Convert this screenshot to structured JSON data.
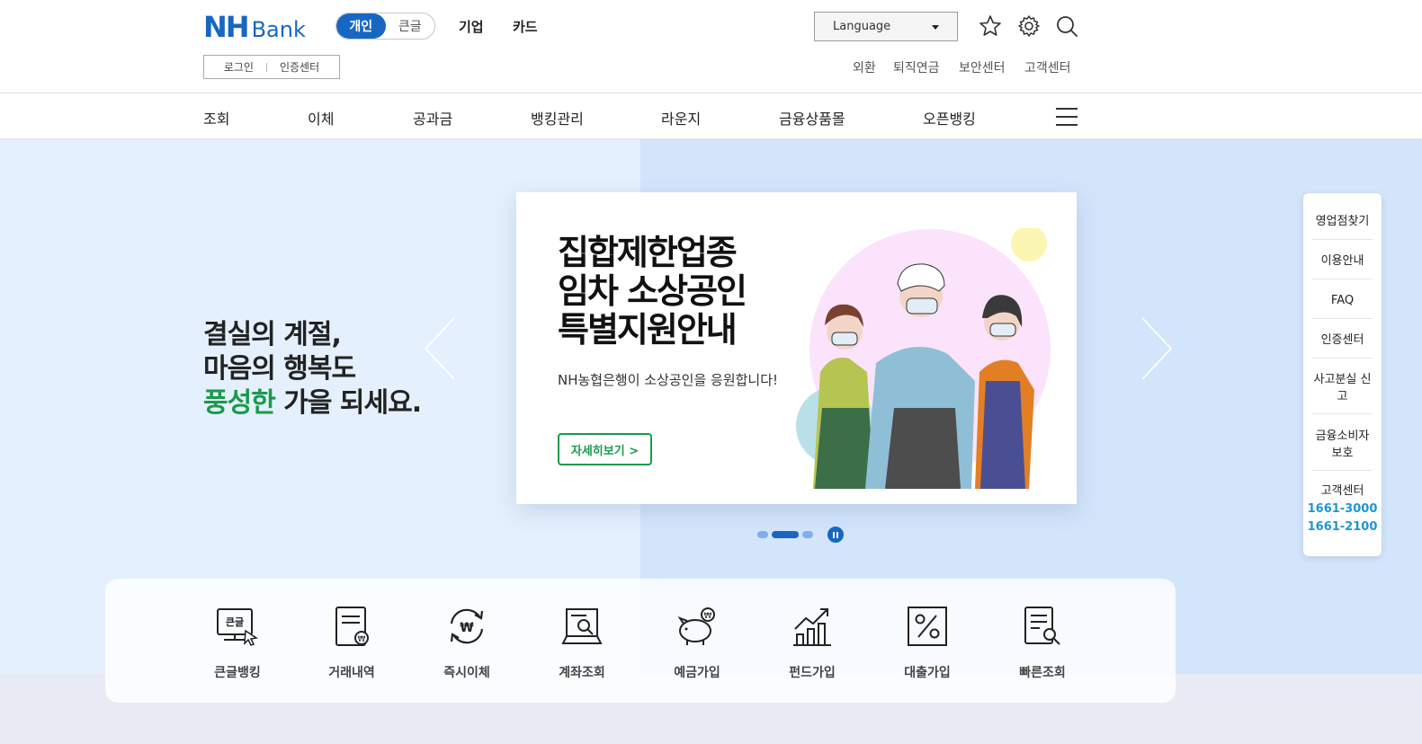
{
  "header": {
    "logo": {
      "nh": "NH",
      "bank": "Bank"
    },
    "mode_tabs": [
      "개인",
      "큰글"
    ],
    "top_links": [
      "기업",
      "카드"
    ],
    "login": "로그인",
    "cert_center": "인증센터",
    "language": "Language",
    "util_links": [
      "외환",
      "퇴직연금",
      "보안센터",
      "고객센터"
    ]
  },
  "nav": {
    "items": [
      "조회",
      "이체",
      "공과금",
      "뱅킹관리",
      "라운지",
      "금융상품몰",
      "오픈뱅킹"
    ]
  },
  "hero": {
    "slogan_line1": "결실의 계절,",
    "slogan_line2": "마음의 행복도",
    "slogan_highlight": "풍성한",
    "slogan_rest": " 가을 되세요."
  },
  "banner": {
    "title_line1": "집합제한업종",
    "title_line2": "임차 소상공인",
    "title_line3": "특별지원안내",
    "subtitle": "NH농협은행이 소상공인을 응원합니다!",
    "button": "자세히보기  >"
  },
  "side_menu": {
    "items": [
      "영업점찾기",
      "이용안내",
      "FAQ",
      "인증센터",
      "사고분실 신고",
      "금융소비자 보호",
      "고객센터"
    ],
    "phones": [
      "1661-3000",
      "1661-2100"
    ]
  },
  "quick": {
    "items": [
      "큰글뱅킹",
      "거래내역",
      "즉시이체",
      "계좌조회",
      "예금가입",
      "펀드가입",
      "대출가입",
      "빠른조회"
    ],
    "bigtext_badge": "큰글"
  },
  "colors": {
    "brand": "#1767c2",
    "green": "#1a9a4c",
    "phone": "#1e96d2"
  }
}
